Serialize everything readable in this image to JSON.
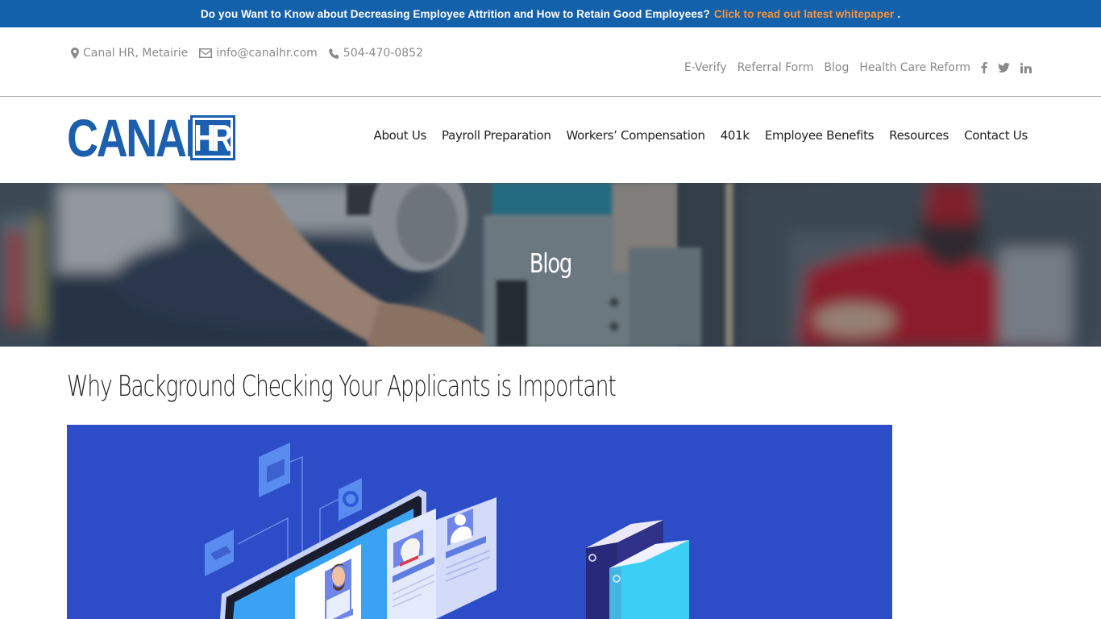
{
  "announcement": {
    "text": "Do you Want to Know about Decreasing Employee Attrition and How to Retain Good Employees?",
    "cta_label": "Click to read out latest whitepaper",
    "suffix": ".",
    "cta_color": "#f7923a",
    "background": "#1461ab"
  },
  "contact": {
    "location_icon": "map-marker-icon",
    "location": "Canal HR, Metairie",
    "email_icon": "envelope-icon",
    "email": "info@canalhr.com",
    "phone_icon": "phone-icon",
    "phone": "504-470-0852"
  },
  "top_links": [
    {
      "label": "E-Verify"
    },
    {
      "label": "Referral Form"
    },
    {
      "label": "Blog"
    },
    {
      "label": "Health Care Reform"
    }
  ],
  "social": [
    {
      "icon": "facebook-icon"
    },
    {
      "icon": "twitter-icon"
    },
    {
      "icon": "linkedin-icon"
    }
  ],
  "logo": {
    "word": "CANAL",
    "badge": "HR",
    "color": "#1b5fae"
  },
  "nav": [
    {
      "label": "About Us"
    },
    {
      "label": "Payroll Preparation"
    },
    {
      "label": "Workers’ Compensation"
    },
    {
      "label": "401k"
    },
    {
      "label": "Employee Benefits"
    },
    {
      "label": "Resources"
    },
    {
      "label": "Contact Us"
    }
  ],
  "hero": {
    "title": "Blog"
  },
  "post": {
    "title": "Why Background Checking Your Applicants is Important",
    "image_background": "#2d4dc8"
  }
}
